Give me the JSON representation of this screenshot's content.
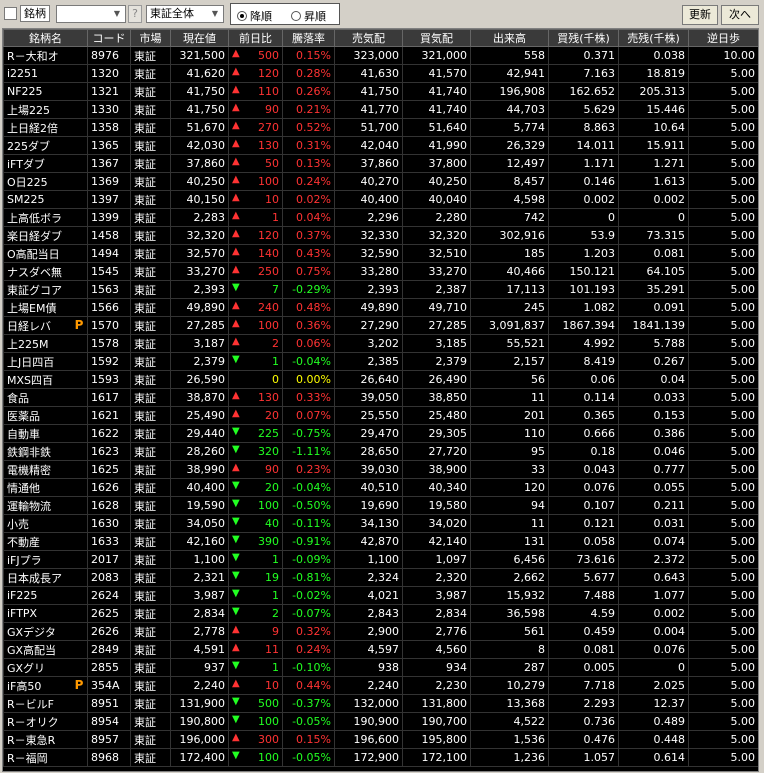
{
  "toolbar": {
    "field_label": "銘柄",
    "question": "?",
    "market_selected": "東証全体",
    "sort_desc": "降順",
    "sort_asc": "昇順",
    "refresh": "更新",
    "next": "次へ"
  },
  "colors": {
    "up": "#ff3333",
    "down": "#22ff22",
    "flat": "#ffff00",
    "badge": "#ff9900"
  },
  "headers": [
    "銘柄名",
    "コード",
    "市場",
    "現在値",
    "前日比",
    "騰落率",
    "売気配",
    "買気配",
    "出来高",
    "買残(千株)",
    "売残(千株)",
    "逆日歩"
  ],
  "rows": [
    {
      "name": "R－大和オ",
      "code": "8976",
      "mkt": "東証",
      "price": "321,500",
      "dir": "up",
      "chg": "500",
      "pct": "0.15%",
      "ask": "323,000",
      "bid": "321,000",
      "vol": "558",
      "buy": "0.371",
      "sell": "0.038",
      "gyaku": "10.00"
    },
    {
      "name": "i2251",
      "code": "1320",
      "mkt": "東証",
      "price": "41,620",
      "dir": "up",
      "chg": "120",
      "pct": "0.28%",
      "ask": "41,630",
      "bid": "41,570",
      "vol": "42,941",
      "buy": "7.163",
      "sell": "18.819",
      "gyaku": "5.00"
    },
    {
      "name": "NF225",
      "code": "1321",
      "mkt": "東証",
      "price": "41,750",
      "dir": "up",
      "chg": "110",
      "pct": "0.26%",
      "ask": "41,750",
      "bid": "41,740",
      "vol": "196,908",
      "buy": "162.652",
      "sell": "205.313",
      "gyaku": "5.00"
    },
    {
      "name": "上場225",
      "code": "1330",
      "mkt": "東証",
      "price": "41,750",
      "dir": "up",
      "chg": "90",
      "pct": "0.21%",
      "ask": "41,770",
      "bid": "41,740",
      "vol": "44,703",
      "buy": "5.629",
      "sell": "15.446",
      "gyaku": "5.00"
    },
    {
      "name": "上日経2倍",
      "code": "1358",
      "mkt": "東証",
      "price": "51,670",
      "dir": "up",
      "chg": "270",
      "pct": "0.52%",
      "ask": "51,700",
      "bid": "51,640",
      "vol": "5,774",
      "buy": "8.863",
      "sell": "10.64",
      "gyaku": "5.00"
    },
    {
      "name": "225ダブ",
      "code": "1365",
      "mkt": "東証",
      "price": "42,030",
      "dir": "up",
      "chg": "130",
      "pct": "0.31%",
      "ask": "42,040",
      "bid": "41,990",
      "vol": "26,329",
      "buy": "14.011",
      "sell": "15.911",
      "gyaku": "5.00"
    },
    {
      "name": "iFTダブ",
      "code": "1367",
      "mkt": "東証",
      "price": "37,860",
      "dir": "up",
      "chg": "50",
      "pct": "0.13%",
      "ask": "37,860",
      "bid": "37,800",
      "vol": "12,497",
      "buy": "1.171",
      "sell": "1.271",
      "gyaku": "5.00"
    },
    {
      "name": "O日225",
      "code": "1369",
      "mkt": "東証",
      "price": "40,250",
      "dir": "up",
      "chg": "100",
      "pct": "0.24%",
      "ask": "40,270",
      "bid": "40,250",
      "vol": "8,457",
      "buy": "0.146",
      "sell": "1.613",
      "gyaku": "5.00"
    },
    {
      "name": "SM225",
      "code": "1397",
      "mkt": "東証",
      "price": "40,150",
      "dir": "up",
      "chg": "10",
      "pct": "0.02%",
      "ask": "40,400",
      "bid": "40,040",
      "vol": "4,598",
      "buy": "0.002",
      "sell": "0.002",
      "gyaku": "5.00"
    },
    {
      "name": "上高低ボラ",
      "code": "1399",
      "mkt": "東証",
      "price": "2,283",
      "dir": "up",
      "chg": "1",
      "pct": "0.04%",
      "ask": "2,296",
      "bid": "2,280",
      "vol": "742",
      "buy": "0",
      "sell": "0",
      "gyaku": "5.00"
    },
    {
      "name": "楽日経ダブ",
      "code": "1458",
      "mkt": "東証",
      "price": "32,320",
      "dir": "up",
      "chg": "120",
      "pct": "0.37%",
      "ask": "32,330",
      "bid": "32,320",
      "vol": "302,916",
      "buy": "53.9",
      "sell": "73.315",
      "gyaku": "5.00"
    },
    {
      "name": "O高配当日",
      "code": "1494",
      "mkt": "東証",
      "price": "32,570",
      "dir": "up",
      "chg": "140",
      "pct": "0.43%",
      "ask": "32,590",
      "bid": "32,510",
      "vol": "185",
      "buy": "1.203",
      "sell": "0.081",
      "gyaku": "5.00"
    },
    {
      "name": "ナスダベ無",
      "code": "1545",
      "mkt": "東証",
      "price": "33,270",
      "dir": "up",
      "chg": "250",
      "pct": "0.75%",
      "ask": "33,280",
      "bid": "33,270",
      "vol": "40,466",
      "buy": "150.121",
      "sell": "64.105",
      "gyaku": "5.00"
    },
    {
      "name": "東証グコア",
      "code": "1563",
      "mkt": "東証",
      "price": "2,393",
      "dir": "dn",
      "chg": "7",
      "pct": "-0.29%",
      "ask": "2,393",
      "bid": "2,387",
      "vol": "17,113",
      "buy": "101.193",
      "sell": "35.291",
      "gyaku": "5.00"
    },
    {
      "name": "上場EM債",
      "code": "1566",
      "mkt": "東証",
      "price": "49,890",
      "dir": "up",
      "chg": "240",
      "pct": "0.48%",
      "ask": "49,890",
      "bid": "49,710",
      "vol": "245",
      "buy": "1.082",
      "sell": "0.091",
      "gyaku": "5.00"
    },
    {
      "name": "日経レバ",
      "code": "1570",
      "mkt": "東証",
      "price": "27,285",
      "dir": "up",
      "chg": "100",
      "pct": "0.36%",
      "ask": "27,290",
      "bid": "27,285",
      "vol": "3,091,837",
      "buy": "1867.394",
      "sell": "1841.139",
      "gyaku": "5.00",
      "badge": "P"
    },
    {
      "name": "上225M",
      "code": "1578",
      "mkt": "東証",
      "price": "3,187",
      "dir": "up",
      "chg": "2",
      "pct": "0.06%",
      "ask": "3,202",
      "bid": "3,185",
      "vol": "55,521",
      "buy": "4.992",
      "sell": "5.788",
      "gyaku": "5.00"
    },
    {
      "name": "上J日四百",
      "code": "1592",
      "mkt": "東証",
      "price": "2,379",
      "dir": "dn",
      "chg": "1",
      "pct": "-0.04%",
      "ask": "2,385",
      "bid": "2,379",
      "vol": "2,157",
      "buy": "8.419",
      "sell": "0.267",
      "gyaku": "5.00"
    },
    {
      "name": "MXS四百",
      "code": "1593",
      "mkt": "東証",
      "price": "26,590",
      "dir": "flat",
      "chg": "0",
      "pct": "0.00%",
      "ask": "26,640",
      "bid": "26,490",
      "vol": "56",
      "buy": "0.06",
      "sell": "0.04",
      "gyaku": "5.00"
    },
    {
      "name": "食品",
      "code": "1617",
      "mkt": "東証",
      "price": "38,870",
      "dir": "up",
      "chg": "130",
      "pct": "0.33%",
      "ask": "39,050",
      "bid": "38,850",
      "vol": "11",
      "buy": "0.114",
      "sell": "0.033",
      "gyaku": "5.00"
    },
    {
      "name": "医薬品",
      "code": "1621",
      "mkt": "東証",
      "price": "25,490",
      "dir": "up",
      "chg": "20",
      "pct": "0.07%",
      "ask": "25,550",
      "bid": "25,480",
      "vol": "201",
      "buy": "0.365",
      "sell": "0.153",
      "gyaku": "5.00"
    },
    {
      "name": "自動車",
      "code": "1622",
      "mkt": "東証",
      "price": "29,440",
      "dir": "dn",
      "chg": "225",
      "pct": "-0.75%",
      "ask": "29,470",
      "bid": "29,305",
      "vol": "110",
      "buy": "0.666",
      "sell": "0.386",
      "gyaku": "5.00"
    },
    {
      "name": "鉄鋼非鉄",
      "code": "1623",
      "mkt": "東証",
      "price": "28,260",
      "dir": "dn",
      "chg": "320",
      "pct": "-1.11%",
      "ask": "28,650",
      "bid": "27,720",
      "vol": "95",
      "buy": "0.18",
      "sell": "0.046",
      "gyaku": "5.00"
    },
    {
      "name": "電機精密",
      "code": "1625",
      "mkt": "東証",
      "price": "38,990",
      "dir": "up",
      "chg": "90",
      "pct": "0.23%",
      "ask": "39,030",
      "bid": "38,900",
      "vol": "33",
      "buy": "0.043",
      "sell": "0.777",
      "gyaku": "5.00"
    },
    {
      "name": "情通他",
      "code": "1626",
      "mkt": "東証",
      "price": "40,400",
      "dir": "dn",
      "chg": "20",
      "pct": "-0.04%",
      "ask": "40,510",
      "bid": "40,340",
      "vol": "120",
      "buy": "0.076",
      "sell": "0.055",
      "gyaku": "5.00"
    },
    {
      "name": "運輸物流",
      "code": "1628",
      "mkt": "東証",
      "price": "19,590",
      "dir": "dn",
      "chg": "100",
      "pct": "-0.50%",
      "ask": "19,690",
      "bid": "19,580",
      "vol": "94",
      "buy": "0.107",
      "sell": "0.211",
      "gyaku": "5.00"
    },
    {
      "name": "小売",
      "code": "1630",
      "mkt": "東証",
      "price": "34,050",
      "dir": "dn",
      "chg": "40",
      "pct": "-0.11%",
      "ask": "34,130",
      "bid": "34,020",
      "vol": "11",
      "buy": "0.121",
      "sell": "0.031",
      "gyaku": "5.00"
    },
    {
      "name": "不動産",
      "code": "1633",
      "mkt": "東証",
      "price": "42,160",
      "dir": "dn",
      "chg": "390",
      "pct": "-0.91%",
      "ask": "42,870",
      "bid": "42,140",
      "vol": "131",
      "buy": "0.058",
      "sell": "0.074",
      "gyaku": "5.00"
    },
    {
      "name": "iFJプラ",
      "code": "2017",
      "mkt": "東証",
      "price": "1,100",
      "dir": "dn",
      "chg": "1",
      "pct": "-0.09%",
      "ask": "1,100",
      "bid": "1,097",
      "vol": "6,456",
      "buy": "73.616",
      "sell": "2.372",
      "gyaku": "5.00"
    },
    {
      "name": "日本成長ア",
      "code": "2083",
      "mkt": "東証",
      "price": "2,321",
      "dir": "dn",
      "chg": "19",
      "pct": "-0.81%",
      "ask": "2,324",
      "bid": "2,320",
      "vol": "2,662",
      "buy": "5.677",
      "sell": "0.643",
      "gyaku": "5.00"
    },
    {
      "name": "iF225",
      "code": "2624",
      "mkt": "東証",
      "price": "3,987",
      "dir": "dn",
      "chg": "1",
      "pct": "-0.02%",
      "ask": "4,021",
      "bid": "3,987",
      "vol": "15,932",
      "buy": "7.488",
      "sell": "1.077",
      "gyaku": "5.00"
    },
    {
      "name": "iFTPX",
      "code": "2625",
      "mkt": "東証",
      "price": "2,834",
      "dir": "dn",
      "chg": "2",
      "pct": "-0.07%",
      "ask": "2,843",
      "bid": "2,834",
      "vol": "36,598",
      "buy": "4.59",
      "sell": "0.002",
      "gyaku": "5.00"
    },
    {
      "name": "GXデジタ",
      "code": "2626",
      "mkt": "東証",
      "price": "2,778",
      "dir": "up",
      "chg": "9",
      "pct": "0.32%",
      "ask": "2,900",
      "bid": "2,776",
      "vol": "561",
      "buy": "0.459",
      "sell": "0.004",
      "gyaku": "5.00"
    },
    {
      "name": "GX高配当",
      "code": "2849",
      "mkt": "東証",
      "price": "4,591",
      "dir": "up",
      "chg": "11",
      "pct": "0.24%",
      "ask": "4,597",
      "bid": "4,560",
      "vol": "8",
      "buy": "0.081",
      "sell": "0.076",
      "gyaku": "5.00"
    },
    {
      "name": "GXグリ",
      "code": "2855",
      "mkt": "東証",
      "price": "937",
      "dir": "dn",
      "chg": "1",
      "pct": "-0.10%",
      "ask": "938",
      "bid": "934",
      "vol": "287",
      "buy": "0.005",
      "sell": "0",
      "gyaku": "5.00"
    },
    {
      "name": "iF高50",
      "code": "354A",
      "mkt": "東証",
      "price": "2,240",
      "dir": "up",
      "chg": "10",
      "pct": "0.44%",
      "ask": "2,240",
      "bid": "2,230",
      "vol": "10,279",
      "buy": "7.718",
      "sell": "2.025",
      "gyaku": "5.00",
      "badge": "P"
    },
    {
      "name": "R－ビルF",
      "code": "8951",
      "mkt": "東証",
      "price": "131,900",
      "dir": "dn",
      "chg": "500",
      "pct": "-0.37%",
      "ask": "132,000",
      "bid": "131,800",
      "vol": "13,368",
      "buy": "2.293",
      "sell": "12.37",
      "gyaku": "5.00"
    },
    {
      "name": "R－オリク",
      "code": "8954",
      "mkt": "東証",
      "price": "190,800",
      "dir": "dn",
      "chg": "100",
      "pct": "-0.05%",
      "ask": "190,900",
      "bid": "190,700",
      "vol": "4,522",
      "buy": "0.736",
      "sell": "0.489",
      "gyaku": "5.00"
    },
    {
      "name": "R－東急R",
      "code": "8957",
      "mkt": "東証",
      "price": "196,000",
      "dir": "up",
      "chg": "300",
      "pct": "0.15%",
      "ask": "196,600",
      "bid": "195,800",
      "vol": "1,536",
      "buy": "0.476",
      "sell": "0.448",
      "gyaku": "5.00"
    },
    {
      "name": "R－福岡",
      "code": "8968",
      "mkt": "東証",
      "price": "172,400",
      "dir": "dn",
      "chg": "100",
      "pct": "-0.05%",
      "ask": "172,900",
      "bid": "172,100",
      "vol": "1,236",
      "buy": "1.057",
      "sell": "0.614",
      "gyaku": "5.00"
    }
  ]
}
